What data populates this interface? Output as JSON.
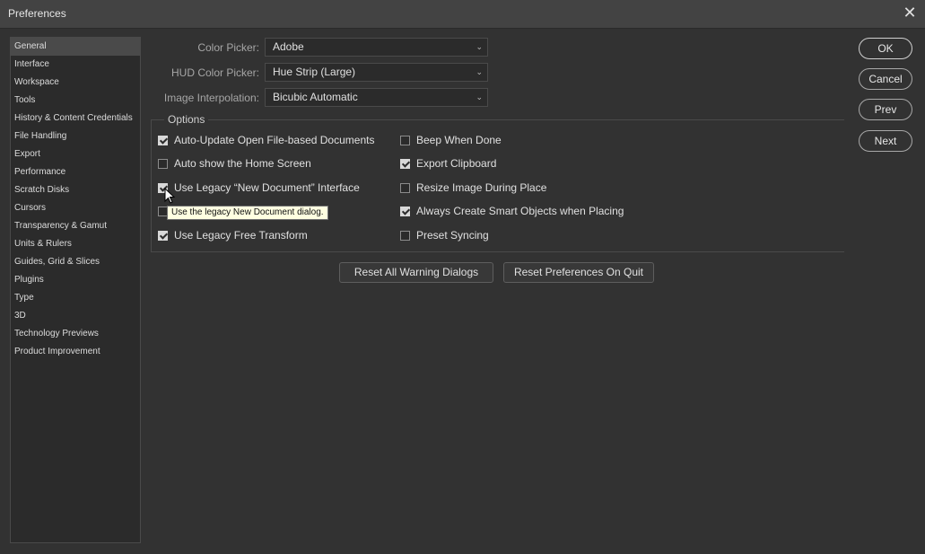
{
  "window": {
    "title": "Preferences",
    "close_glyph": "✕"
  },
  "sidebar": {
    "items": [
      {
        "label": "General",
        "selected": true
      },
      {
        "label": "Interface"
      },
      {
        "label": "Workspace"
      },
      {
        "label": "Tools"
      },
      {
        "label": "History & Content Credentials"
      },
      {
        "label": "File Handling"
      },
      {
        "label": "Export"
      },
      {
        "label": "Performance"
      },
      {
        "label": "Scratch Disks"
      },
      {
        "label": "Cursors"
      },
      {
        "label": "Transparency & Gamut"
      },
      {
        "label": "Units & Rulers"
      },
      {
        "label": "Guides, Grid & Slices"
      },
      {
        "label": "Plugins"
      },
      {
        "label": "Type"
      },
      {
        "label": "3D"
      },
      {
        "label": "Technology Previews"
      },
      {
        "label": "Product Improvement"
      }
    ]
  },
  "fields": {
    "color_picker": {
      "label": "Color Picker:",
      "value": "Adobe"
    },
    "hud_color_picker": {
      "label": "HUD Color Picker:",
      "value": "Hue Strip (Large)"
    },
    "image_interpolation": {
      "label": "Image Interpolation:",
      "value": "Bicubic Automatic"
    },
    "chevron_glyph": "⌄"
  },
  "options": {
    "title": "Options",
    "left": [
      {
        "label": "Auto-Update Open File-based Documents",
        "checked": true
      },
      {
        "label": "Auto show the Home Screen",
        "checked": false
      },
      {
        "label": "Use Legacy “New Document” Interface",
        "checked": true
      },
      {
        "label": "",
        "checked": false
      },
      {
        "label": "Use Legacy Free Transform",
        "checked": true
      }
    ],
    "right": [
      {
        "label": "Beep When Done",
        "checked": false
      },
      {
        "label": "Export Clipboard",
        "checked": true
      },
      {
        "label": "Resize Image During Place",
        "checked": false
      },
      {
        "label": "Always Create Smart Objects when Placing",
        "checked": true
      },
      {
        "label": "Preset Syncing",
        "checked": false
      }
    ]
  },
  "tooltip": {
    "text": "Use the legacy New Document dialog."
  },
  "actions": {
    "reset_warnings": "Reset All Warning Dialogs",
    "reset_on_quit": "Reset Preferences On Quit"
  },
  "dialog_buttons": {
    "ok": "OK",
    "cancel": "Cancel",
    "prev": "Prev",
    "next": "Next"
  },
  "colors": {
    "background": "#323232",
    "titlebar": "#434343",
    "tooltip_bg": "#ffffe1"
  }
}
